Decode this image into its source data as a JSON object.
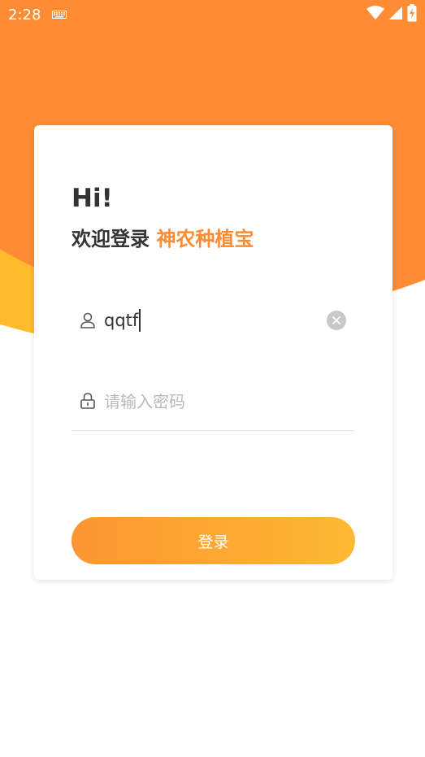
{
  "status_bar": {
    "time": "2:28",
    "icons": [
      "keyboard-icon",
      "wifi-icon",
      "signal-icon",
      "battery-icon"
    ]
  },
  "login": {
    "greeting": "Hi!",
    "welcome_prefix": "欢迎登录",
    "app_name": "神农种植宝",
    "username_value": "qqtf",
    "password_placeholder": "请输入密码",
    "submit_label": "登录"
  },
  "colors": {
    "accent": "#fd8c34",
    "accent_yellow": "#fdbb2d",
    "text": "#333333",
    "placeholder": "#b9b9b9"
  }
}
